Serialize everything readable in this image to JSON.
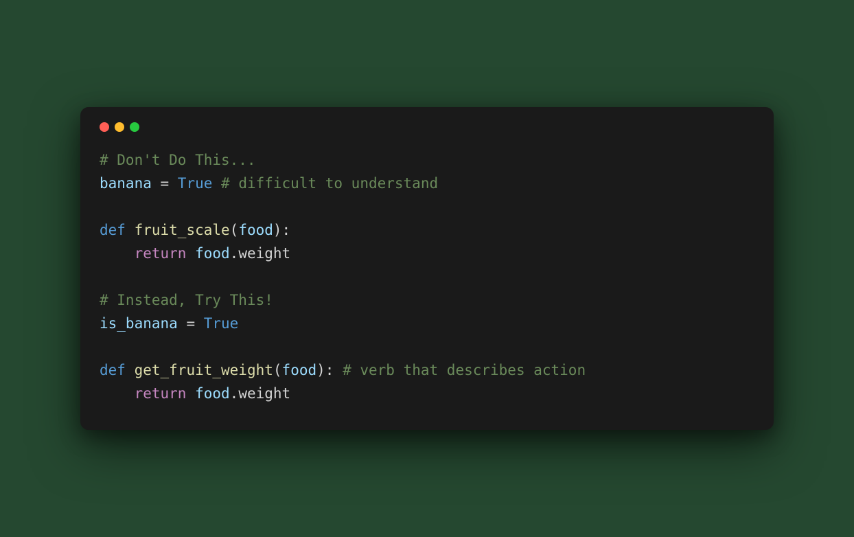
{
  "colors": {
    "background": "#254830",
    "window": "#1a1a1a",
    "dot_red": "#ff5f56",
    "dot_yellow": "#ffbd2e",
    "dot_green": "#27c93f",
    "comment": "#6a8a5a",
    "identifier": "#9cdcfe",
    "keyword": "#c586c0",
    "constant": "#569cd6",
    "function": "#dcdcaa"
  },
  "line1": {
    "comment": "# Don't Do This..."
  },
  "line2": {
    "ident": "banana",
    "op": " = ",
    "const": "True",
    "space": " ",
    "comment": "# difficult to understand"
  },
  "line4": {
    "def": "def",
    "sp1": " ",
    "func": "fruit_scale",
    "lparen": "(",
    "param": "food",
    "rparen_colon": "):"
  },
  "line5": {
    "indent": "    ",
    "ret": "return",
    "sp": " ",
    "obj": "food",
    "dot": ".",
    "prop": "weight"
  },
  "line7": {
    "comment": "# Instead, Try This!"
  },
  "line8": {
    "ident": "is_banana",
    "op": " = ",
    "const": "True"
  },
  "line10": {
    "def": "def",
    "sp1": " ",
    "func": "get_fruit_weight",
    "lparen": "(",
    "param": "food",
    "rparen_colon": "):",
    "space": " ",
    "comment": "# verb that describes action"
  },
  "line11": {
    "indent": "    ",
    "ret": "return",
    "sp": " ",
    "obj": "food",
    "dot": ".",
    "prop": "weight"
  }
}
